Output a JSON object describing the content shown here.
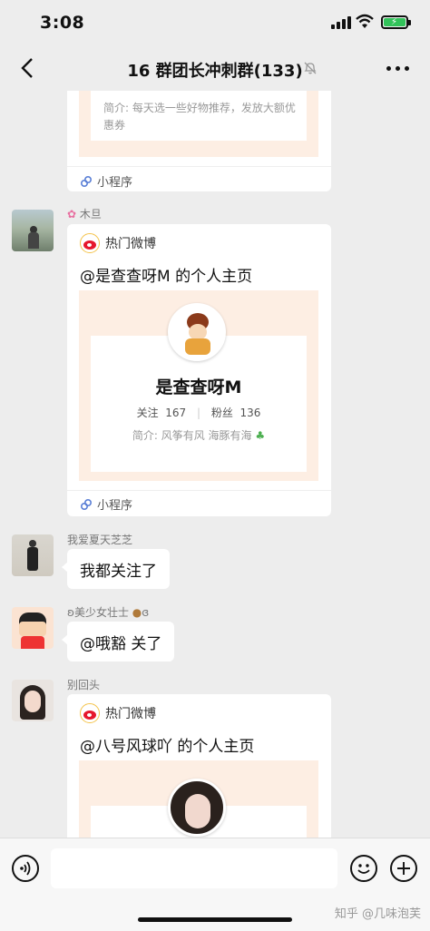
{
  "status": {
    "time": "3:08"
  },
  "nav": {
    "title": "16 群团长冲刺群(133)"
  },
  "messages": {
    "card0": {
      "intro": "简介: 每天选一些好物推荐，发放大额优惠券",
      "mini_label": "小程序"
    },
    "card1": {
      "sender": "木旦",
      "source": "热门微博",
      "headline": "@是查查呀M 的个人主页",
      "name": "是查查呀M",
      "follow_label": "关注",
      "follow_count": "167",
      "fans_label": "粉丝",
      "fans_count": "136",
      "intro": "简介: 风筝有风 海豚有海",
      "mini_label": "小程序"
    },
    "msg2": {
      "sender": "我爱夏天芝芝",
      "text": "我都关注了"
    },
    "msg3": {
      "sender": "美少女壮士",
      "text": "@哦豁 关了"
    },
    "card4": {
      "sender": "别回头",
      "source": "热门微博",
      "headline": "@八号风球吖 的个人主页"
    }
  },
  "watermark": "知乎 @几味泡芙",
  "colors": {
    "accent": "#fdeee3",
    "bg": "#ededed",
    "battery": "#32c25a"
  }
}
